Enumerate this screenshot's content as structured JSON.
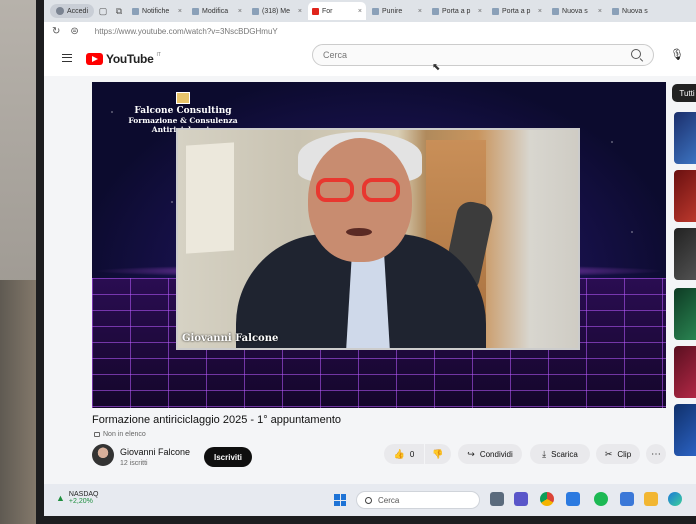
{
  "browser": {
    "profile_label": "Accedi",
    "tabs": [
      {
        "label": "Notifiche"
      },
      {
        "label": "Modifica"
      },
      {
        "label": "(318) Me"
      },
      {
        "label": "For"
      },
      {
        "label": "Punire"
      },
      {
        "label": "Porta a p"
      },
      {
        "label": "Porta a p"
      },
      {
        "label": "Nuova s"
      },
      {
        "label": "Nuova s"
      }
    ],
    "url": "https://www.youtube.com/watch?v=3NscBDGHmuY"
  },
  "youtube": {
    "logo_text": "YouTube",
    "logo_region": "IT",
    "search_placeholder": "Cerca",
    "right_chip": "Tutti"
  },
  "video": {
    "brand_name": "Falcone Consulting",
    "brand_tagline": "Formazione & Consulenza Antiriciclaggio",
    "speaker_caption": "Giovanni Falcone"
  },
  "meta": {
    "title": "Formazione antiriciclaggio 2025 - 1° appuntamento",
    "visibility": "Non in elenco",
    "channel_name": "Giovanni Falcone",
    "subscribers": "12 iscritti",
    "subscribe_label": "Iscriviti",
    "like_count": "0",
    "share_label": "Condividi",
    "download_label": "Scarica",
    "clip_label": "Clip"
  },
  "taskbar": {
    "stock_name": "NASDAQ",
    "stock_change": "+2,20%",
    "search_placeholder": "Cerca"
  },
  "colors": {
    "youtube_red": "#ff0000",
    "subscribe_bg": "#0f0f0f",
    "glasses": "#e8372f",
    "stock_up": "#1e8e3e"
  },
  "icons": [
    "hamburger-icon",
    "search-icon",
    "mic-icon",
    "thumbs-up-icon",
    "thumbs-down-icon",
    "share-icon",
    "download-icon",
    "clip-icon",
    "more-icon",
    "windows-icon",
    "lock-icon"
  ]
}
